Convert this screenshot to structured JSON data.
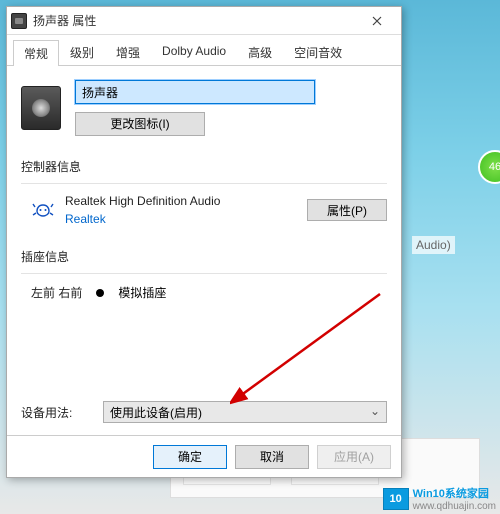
{
  "window": {
    "title": "扬声器 属性",
    "tabs": [
      "常规",
      "级别",
      "增强",
      "Dolby Audio",
      "高级",
      "空间音效"
    ],
    "active_tab": 0
  },
  "device": {
    "name_value": "扬声器",
    "change_icon_label": "更改图标(I)"
  },
  "controller": {
    "section_title": "控制器信息",
    "name": "Realtek High Definition Audio",
    "vendor": "Realtek",
    "properties_label": "属性(P)"
  },
  "jack": {
    "section_title": "插座信息",
    "position": "左前 右前",
    "type": "模拟插座"
  },
  "usage": {
    "label": "设备用法:",
    "selected": "使用此设备(启用)"
  },
  "footer": {
    "ok": "确定",
    "cancel": "取消",
    "apply": "应用(A)"
  },
  "background": {
    "audio_text": "Audio)",
    "badge_value": "46"
  },
  "watermark": {
    "brand": "Win10系统家园",
    "url": "www.qdhuajin.com",
    "icon_text": "10"
  }
}
